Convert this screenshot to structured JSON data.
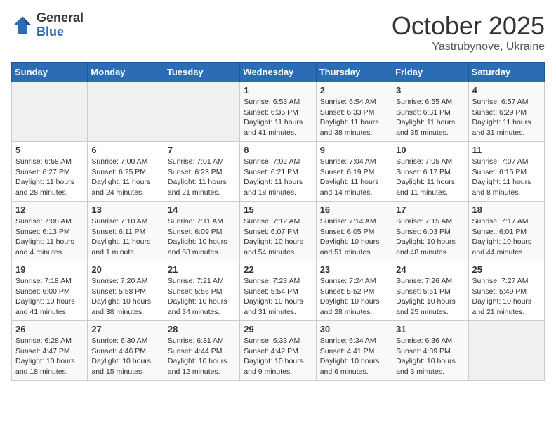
{
  "logo": {
    "general": "General",
    "blue": "Blue"
  },
  "title": "October 2025",
  "subtitle": "Yastrubynove, Ukraine",
  "days_of_week": [
    "Sunday",
    "Monday",
    "Tuesday",
    "Wednesday",
    "Thursday",
    "Friday",
    "Saturday"
  ],
  "weeks": [
    [
      {
        "num": "",
        "info": ""
      },
      {
        "num": "",
        "info": ""
      },
      {
        "num": "",
        "info": ""
      },
      {
        "num": "1",
        "info": "Sunrise: 6:53 AM\nSunset: 6:35 PM\nDaylight: 11 hours and 41 minutes."
      },
      {
        "num": "2",
        "info": "Sunrise: 6:54 AM\nSunset: 6:33 PM\nDaylight: 11 hours and 38 minutes."
      },
      {
        "num": "3",
        "info": "Sunrise: 6:55 AM\nSunset: 6:31 PM\nDaylight: 11 hours and 35 minutes."
      },
      {
        "num": "4",
        "info": "Sunrise: 6:57 AM\nSunset: 6:29 PM\nDaylight: 11 hours and 31 minutes."
      }
    ],
    [
      {
        "num": "5",
        "info": "Sunrise: 6:58 AM\nSunset: 6:27 PM\nDaylight: 11 hours and 28 minutes."
      },
      {
        "num": "6",
        "info": "Sunrise: 7:00 AM\nSunset: 6:25 PM\nDaylight: 11 hours and 24 minutes."
      },
      {
        "num": "7",
        "info": "Sunrise: 7:01 AM\nSunset: 6:23 PM\nDaylight: 11 hours and 21 minutes."
      },
      {
        "num": "8",
        "info": "Sunrise: 7:02 AM\nSunset: 6:21 PM\nDaylight: 11 hours and 18 minutes."
      },
      {
        "num": "9",
        "info": "Sunrise: 7:04 AM\nSunset: 6:19 PM\nDaylight: 11 hours and 14 minutes."
      },
      {
        "num": "10",
        "info": "Sunrise: 7:05 AM\nSunset: 6:17 PM\nDaylight: 11 hours and 11 minutes."
      },
      {
        "num": "11",
        "info": "Sunrise: 7:07 AM\nSunset: 6:15 PM\nDaylight: 11 hours and 8 minutes."
      }
    ],
    [
      {
        "num": "12",
        "info": "Sunrise: 7:08 AM\nSunset: 6:13 PM\nDaylight: 11 hours and 4 minutes."
      },
      {
        "num": "13",
        "info": "Sunrise: 7:10 AM\nSunset: 6:11 PM\nDaylight: 11 hours and 1 minute."
      },
      {
        "num": "14",
        "info": "Sunrise: 7:11 AM\nSunset: 6:09 PM\nDaylight: 10 hours and 58 minutes."
      },
      {
        "num": "15",
        "info": "Sunrise: 7:12 AM\nSunset: 6:07 PM\nDaylight: 10 hours and 54 minutes."
      },
      {
        "num": "16",
        "info": "Sunrise: 7:14 AM\nSunset: 6:05 PM\nDaylight: 10 hours and 51 minutes."
      },
      {
        "num": "17",
        "info": "Sunrise: 7:15 AM\nSunset: 6:03 PM\nDaylight: 10 hours and 48 minutes."
      },
      {
        "num": "18",
        "info": "Sunrise: 7:17 AM\nSunset: 6:01 PM\nDaylight: 10 hours and 44 minutes."
      }
    ],
    [
      {
        "num": "19",
        "info": "Sunrise: 7:18 AM\nSunset: 6:00 PM\nDaylight: 10 hours and 41 minutes."
      },
      {
        "num": "20",
        "info": "Sunrise: 7:20 AM\nSunset: 5:58 PM\nDaylight: 10 hours and 38 minutes."
      },
      {
        "num": "21",
        "info": "Sunrise: 7:21 AM\nSunset: 5:56 PM\nDaylight: 10 hours and 34 minutes."
      },
      {
        "num": "22",
        "info": "Sunrise: 7:23 AM\nSunset: 5:54 PM\nDaylight: 10 hours and 31 minutes."
      },
      {
        "num": "23",
        "info": "Sunrise: 7:24 AM\nSunset: 5:52 PM\nDaylight: 10 hours and 28 minutes."
      },
      {
        "num": "24",
        "info": "Sunrise: 7:26 AM\nSunset: 5:51 PM\nDaylight: 10 hours and 25 minutes."
      },
      {
        "num": "25",
        "info": "Sunrise: 7:27 AM\nSunset: 5:49 PM\nDaylight: 10 hours and 21 minutes."
      }
    ],
    [
      {
        "num": "26",
        "info": "Sunrise: 6:28 AM\nSunset: 4:47 PM\nDaylight: 10 hours and 18 minutes."
      },
      {
        "num": "27",
        "info": "Sunrise: 6:30 AM\nSunset: 4:46 PM\nDaylight: 10 hours and 15 minutes."
      },
      {
        "num": "28",
        "info": "Sunrise: 6:31 AM\nSunset: 4:44 PM\nDaylight: 10 hours and 12 minutes."
      },
      {
        "num": "29",
        "info": "Sunrise: 6:33 AM\nSunset: 4:42 PM\nDaylight: 10 hours and 9 minutes."
      },
      {
        "num": "30",
        "info": "Sunrise: 6:34 AM\nSunset: 4:41 PM\nDaylight: 10 hours and 6 minutes."
      },
      {
        "num": "31",
        "info": "Sunrise: 6:36 AM\nSunset: 4:39 PM\nDaylight: 10 hours and 3 minutes."
      },
      {
        "num": "",
        "info": ""
      }
    ]
  ]
}
